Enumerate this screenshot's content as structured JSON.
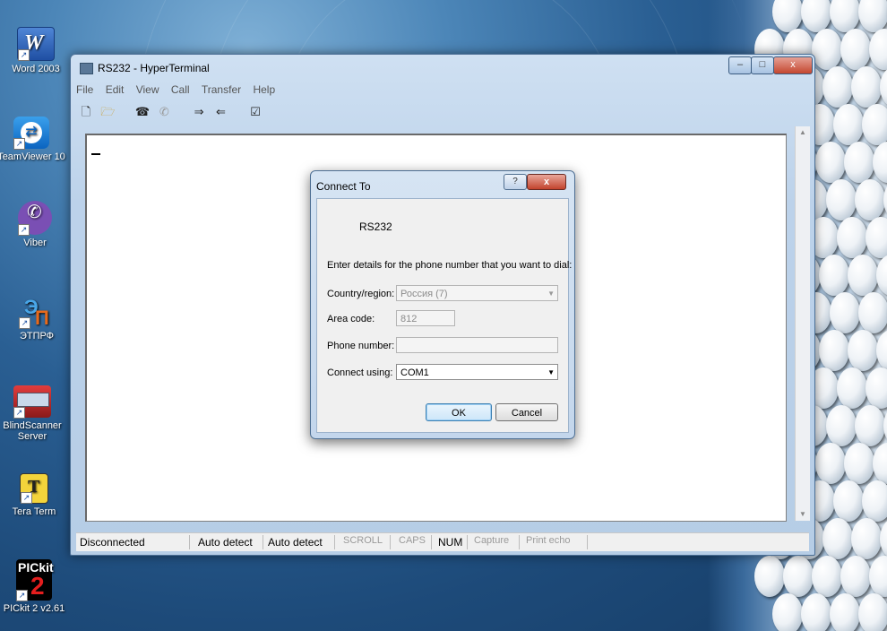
{
  "desktop": {
    "icons": [
      {
        "label": "Word 2003",
        "icon": "word-icon"
      },
      {
        "label": "TeamViewer 10",
        "icon": "teamviewer-icon"
      },
      {
        "label": "Viber",
        "icon": "viber-icon"
      },
      {
        "label": "ЭТПРФ",
        "icon": "etprf-icon"
      },
      {
        "label": "BlindScanner Server",
        "icon": "blindscanner-icon"
      },
      {
        "label": "Tera Term",
        "icon": "teraterm-icon"
      },
      {
        "label": "PICkit 2 v2.61",
        "icon": "pickit-icon"
      }
    ]
  },
  "window": {
    "title": "RS232 - HyperTerminal",
    "controls": {
      "minimize": "–",
      "maximize": "□",
      "close": "x"
    },
    "menu": [
      "File",
      "Edit",
      "View",
      "Call",
      "Transfer",
      "Help"
    ],
    "toolbar_icons": [
      "new-icon",
      "open-icon",
      "connect-icon",
      "disconnect-icon",
      "send-icon",
      "receive-icon",
      "properties-icon"
    ],
    "status": {
      "connection": "Disconnected",
      "detect1": "Auto detect",
      "detect2": "Auto detect",
      "scroll": "SCROLL",
      "caps": "CAPS",
      "num": "NUM",
      "capture": "Capture",
      "print_echo": "Print echo"
    }
  },
  "dialog": {
    "title": "Connect To",
    "help_button": "?",
    "close_button": "x",
    "connection_name": "RS232",
    "instruction": "Enter details for the phone number that you want to dial:",
    "country_label": "Country/region:",
    "country_value": "Россия (7)",
    "area_code_label": "Area code:",
    "area_code_value": "812",
    "phone_label": "Phone number:",
    "phone_value": "",
    "connect_using_label": "Connect using:",
    "connect_using_value": "COM1",
    "ok_label": "OK",
    "cancel_label": "Cancel"
  },
  "colors": {
    "accent": "#3c7fb1",
    "close_red": "#c3462f"
  }
}
